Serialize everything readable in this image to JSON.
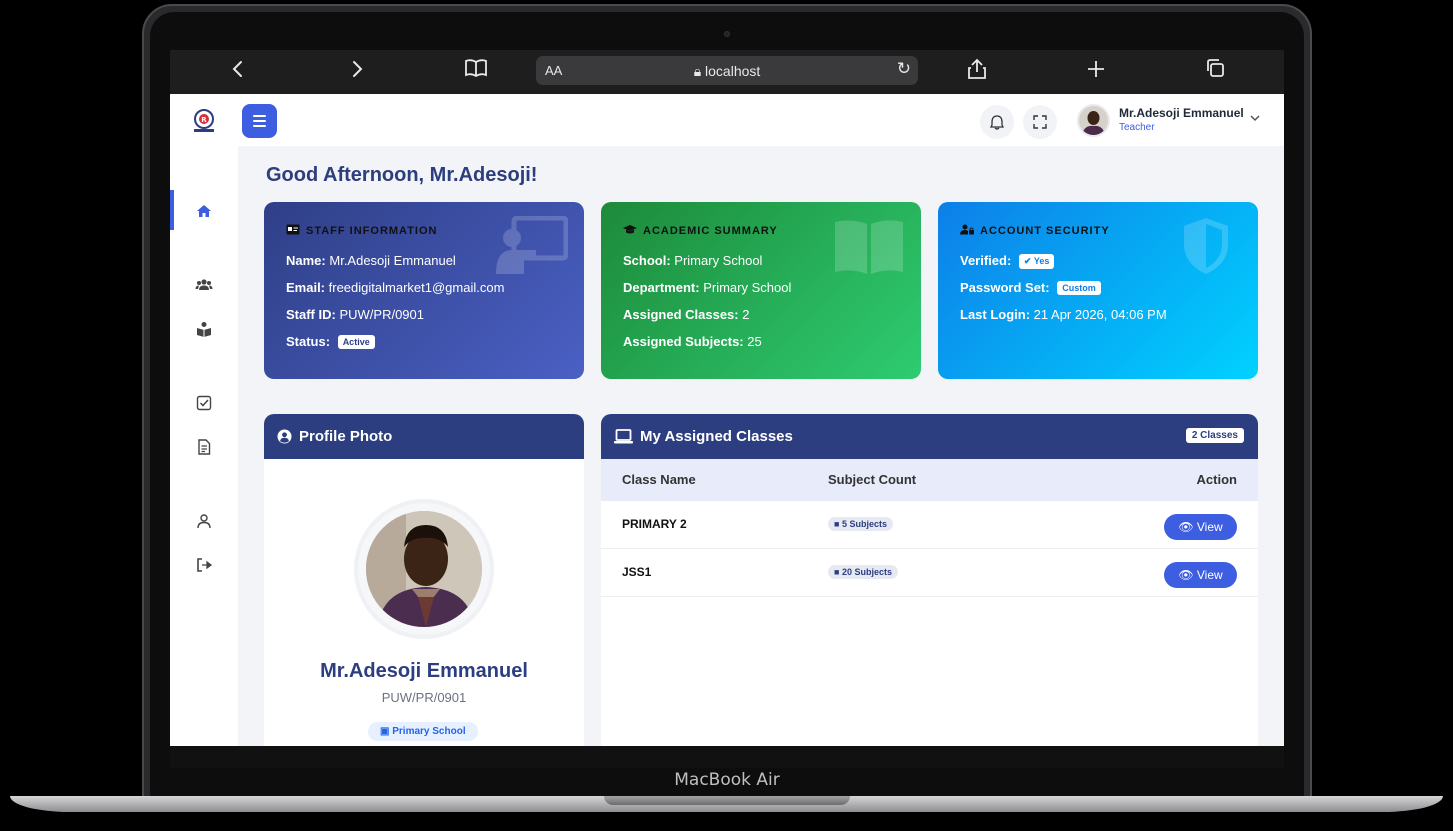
{
  "device": {
    "label": "MacBook Air"
  },
  "browser": {
    "url": "localhost",
    "text_size_label": "AA"
  },
  "header": {
    "user_name": "Mr.Adesoji Emmanuel",
    "user_role": "Teacher"
  },
  "greeting": "Good Afternoon, Mr.Adesoji!",
  "staff_info": {
    "title": "STAFF INFORMATION",
    "name_label": "Name:",
    "name": "Mr.Adesoji Emmanuel",
    "email_label": "Email:",
    "email": "freedigitalmarket1@gmail.com",
    "staff_id_label": "Staff ID:",
    "staff_id": "PUW/PR/0901",
    "status_label": "Status:",
    "status": "Active"
  },
  "academic_summary": {
    "title": "ACADEMIC SUMMARY",
    "school_label": "School:",
    "school": "Primary School",
    "department_label": "Department:",
    "department": "Primary School",
    "classes_label": "Assigned Classes:",
    "classes": "2",
    "subjects_label": "Assigned Subjects:",
    "subjects": "25"
  },
  "account_security": {
    "title": "ACCOUNT SECURITY",
    "verified_label": "Verified:",
    "verified": "Yes",
    "password_label": "Password Set:",
    "password": "Custom",
    "last_login_label": "Last Login:",
    "last_login": "21 Apr 2026, 04:06 PM"
  },
  "profile": {
    "title": "Profile Photo",
    "name": "Mr.Adesoji Emmanuel",
    "staff_id": "PUW/PR/0901",
    "school": "Primary School"
  },
  "classes": {
    "title": "My Assigned Classes",
    "count_badge": "2 Classes",
    "columns": [
      "Class Name",
      "Subject Count",
      "Action"
    ],
    "rows": [
      {
        "name": "PRIMARY 2",
        "subjects": "5 Subjects",
        "action": "View"
      },
      {
        "name": "JSS1",
        "subjects": "20 Subjects",
        "action": "View"
      }
    ]
  },
  "colors": {
    "primary": "#3d5ee1",
    "navy": "#2c3e80",
    "green": "#1d8a3a",
    "cyan": "#00d2ff"
  }
}
